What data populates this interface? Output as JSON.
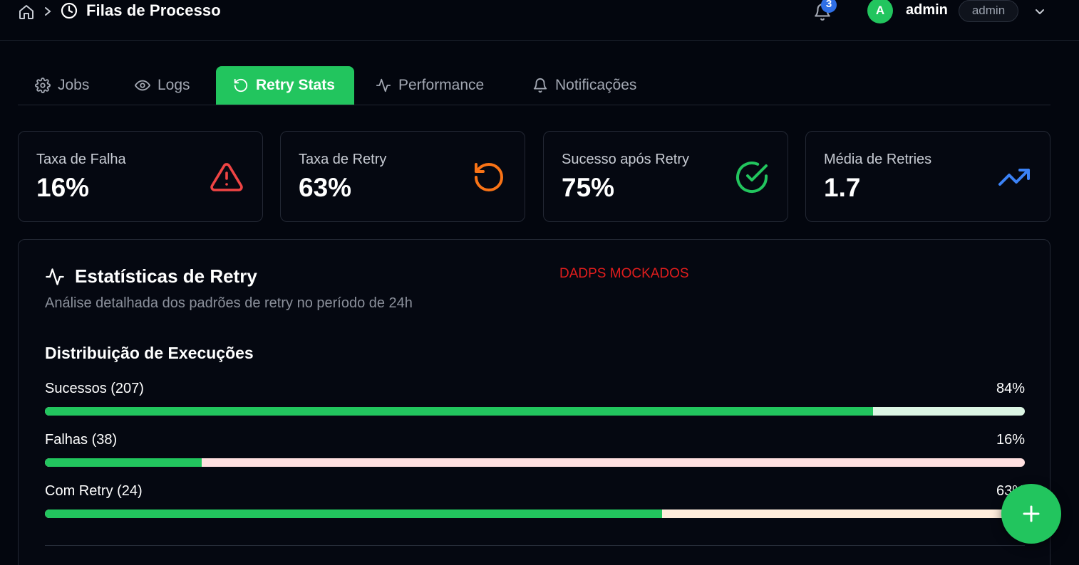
{
  "header": {
    "title": "Filas de Processo",
    "notification_count": "3",
    "avatar_initial": "A",
    "user_name": "admin",
    "role": "admin"
  },
  "tabs": [
    {
      "label": "Jobs",
      "icon": "gear-icon",
      "active": false
    },
    {
      "label": "Logs",
      "icon": "eye-icon",
      "active": false
    },
    {
      "label": "Retry Stats",
      "icon": "rotate-ccw-icon",
      "active": true
    },
    {
      "label": "Performance",
      "icon": "activity-icon",
      "active": false
    },
    {
      "label": "Notificações",
      "icon": "bell-icon",
      "active": false
    }
  ],
  "stats": [
    {
      "label": "Taxa de Falha",
      "value": "16%",
      "icon": "alert-triangle-icon",
      "color": "#ef4444"
    },
    {
      "label": "Taxa de Retry",
      "value": "63%",
      "icon": "rotate-ccw-icon",
      "color": "#f97316"
    },
    {
      "label": "Sucesso após Retry",
      "value": "75%",
      "icon": "check-circle-icon",
      "color": "#22c55e"
    },
    {
      "label": "Média de Retries",
      "value": "1.7",
      "icon": "trending-up-icon",
      "color": "#3b82f6"
    }
  ],
  "panel": {
    "title": "Estatísticas de Retry",
    "mock_note": "DADPS MOCKADOS",
    "subtitle": "Análise detalhada dos padrões de retry no período de 24h",
    "distribution_title": "Distribuição de Execuções",
    "rows": [
      {
        "label": "Sucessos (207)",
        "percent_text": "84%",
        "percent": 84.5,
        "track_color": "#dcf5e4"
      },
      {
        "label": "Falhas (38)",
        "percent_text": "16%",
        "percent": 16,
        "track_color": "#ffe0e0"
      },
      {
        "label": "Com Retry (24)",
        "percent_text": "63%",
        "percent": 63,
        "track_color": "#ffeddc"
      }
    ]
  },
  "colors": {
    "accent": "#22c55e",
    "background": "#03060e",
    "badge": "#2f6fe6"
  }
}
